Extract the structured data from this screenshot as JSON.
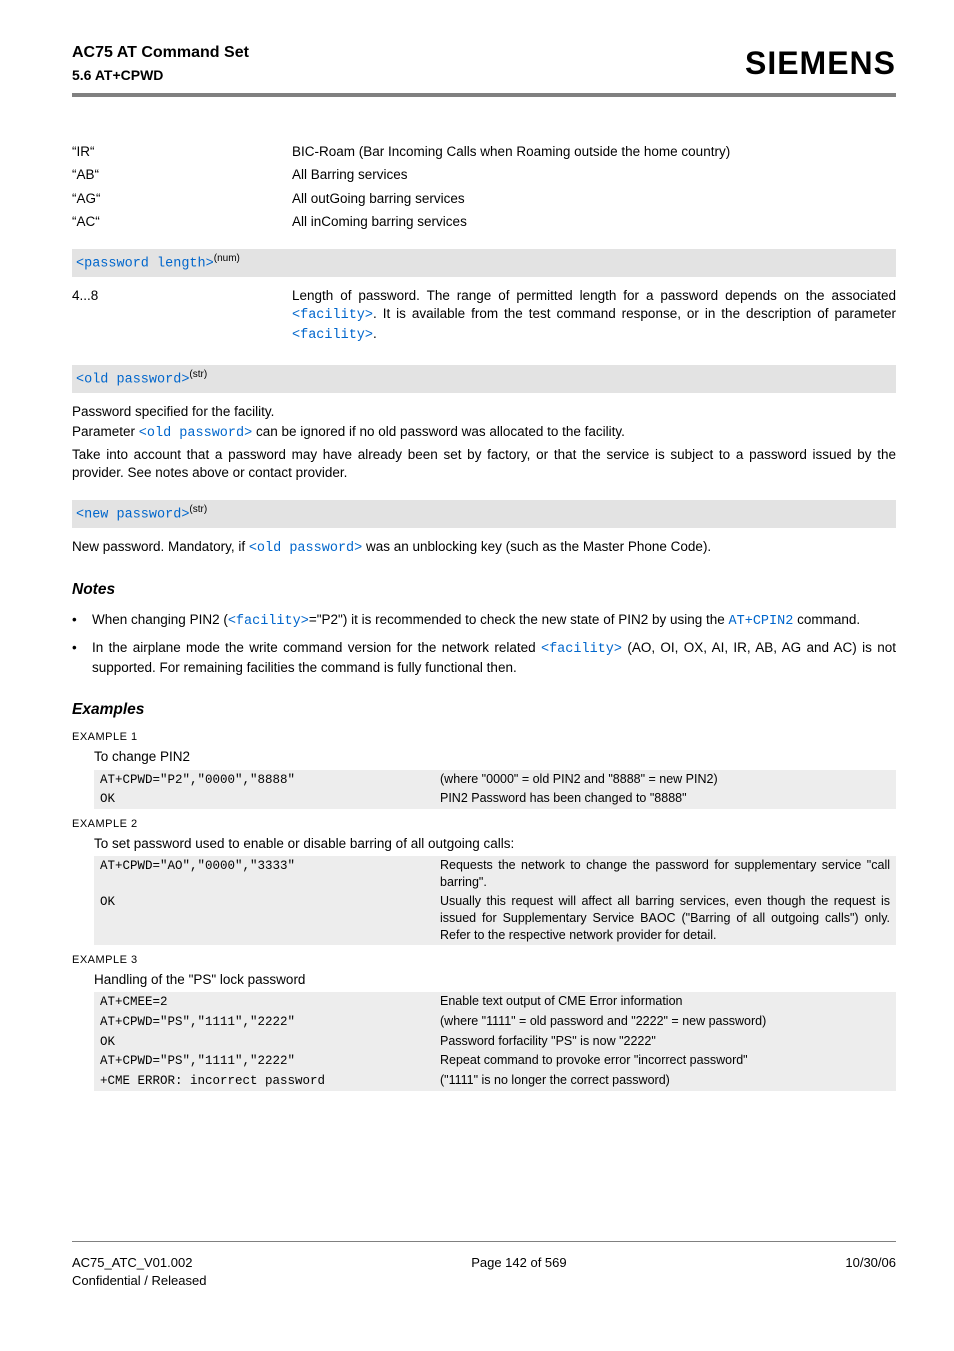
{
  "header": {
    "title_line_1": "AC75 AT Command Set",
    "title_line_2": "5.6 AT+CPWD",
    "brand": "SIEMENS"
  },
  "facility_rows": [
    {
      "key": "“IR“",
      "val": "BIC-Roam (Bar Incoming Calls when Roaming outside the home country)"
    },
    {
      "key": "“AB“",
      "val": "All Barring services"
    },
    {
      "key": "“AG“",
      "val": "All outGoing barring services"
    },
    {
      "key": "“AC“",
      "val": "All inComing barring services"
    }
  ],
  "param_pwlen": {
    "bar": "<password length>",
    "sup": "(num)",
    "range": "4...8",
    "desc_parts": {
      "a": "Length of password. The range of permitted length for a password depends on the associated ",
      "b": "<facility>",
      "c": ". It is available from the test command response, or in the description of parameter ",
      "d": "<facility>",
      "e": "."
    }
  },
  "param_oldpw": {
    "bar": "<old password>",
    "sup": "(str)",
    "p1": "Password specified for the facility.",
    "p2a": "Parameter ",
    "p2b": "<old password>",
    "p2c": " can be ignored if no old password was allocated to the facility.",
    "p3": "Take into account that a password may have already been set by factory, or that the service is subject to a password issued by the provider. See notes above or contact provider."
  },
  "param_newpw": {
    "bar": "<new password>",
    "sup": "(str)",
    "p_a": "New password. Mandatory, if ",
    "p_b": "<old password>",
    "p_c": " was an unblocking key (such as the Master Phone Code)."
  },
  "notes_heading": "Notes",
  "notes": [
    {
      "parts": [
        "When changing PIN2 (",
        "<facility>",
        "=\"P2\") it is recommended to check the new state of PIN2 by using the ",
        "AT+CPIN2",
        " command."
      ]
    },
    {
      "parts": [
        "In the airplane mode the write command version for the network related ",
        "<facility>",
        " (AO, OI, OX, AI, IR, AB, AG and AC) is not supported. For remaining facilities the command is fully functional then."
      ]
    }
  ],
  "examples_heading": "Examples",
  "examples": {
    "ex1": {
      "label": "EXAMPLE 1",
      "intro": "To change PIN2",
      "rows": [
        {
          "cmd": "AT+CPWD=\"P2\",\"0000\",\"8888\"",
          "desc": "(where \"0000\" = old PIN2 and \"8888\" = new PIN2)"
        },
        {
          "cmd": "OK",
          "desc": "PIN2 Password has been changed to \"8888\""
        }
      ]
    },
    "ex2": {
      "label": "EXAMPLE 2",
      "intro": "To set password used to enable or disable barring of all outgoing calls:",
      "rows": [
        {
          "cmd": "AT+CPWD=\"AO\",\"0000\",\"3333\"",
          "desc": "Requests the network to change the password for supplementary service \"call barring\"."
        },
        {
          "cmd": "OK",
          "desc": "Usually this request will affect all barring services, even though the request is issued for Supplementary Service BAOC (\"Barring of all outgoing calls\") only. Refer to the respective network provider for detail."
        }
      ]
    },
    "ex3": {
      "label": "EXAMPLE 3",
      "intro": "Handling of the \"PS\" lock password",
      "rows": [
        {
          "cmd": "AT+CMEE=2",
          "desc": "Enable text output of CME Error information"
        },
        {
          "cmd": "AT+CPWD=\"PS\",\"1111\",\"2222\"",
          "desc": "(where \"1111\" = old password and \"2222\" = new password)"
        },
        {
          "cmd": "OK",
          "desc": "Password forfacility \"PS\" is now \"2222\""
        },
        {
          "cmd": "AT+CPWD=\"PS\",\"1111\",\"2222\"",
          "desc": "Repeat command to provoke error \"incorrect password\""
        },
        {
          "cmd": "+CME ERROR: incorrect password",
          "desc": "(\"1111\" is no longer the correct password)"
        }
      ]
    }
  },
  "footer": {
    "left1": "AC75_ATC_V01.002",
    "center": "Page 142 of 569",
    "right": "10/30/06",
    "left2": "Confidential / Released"
  }
}
